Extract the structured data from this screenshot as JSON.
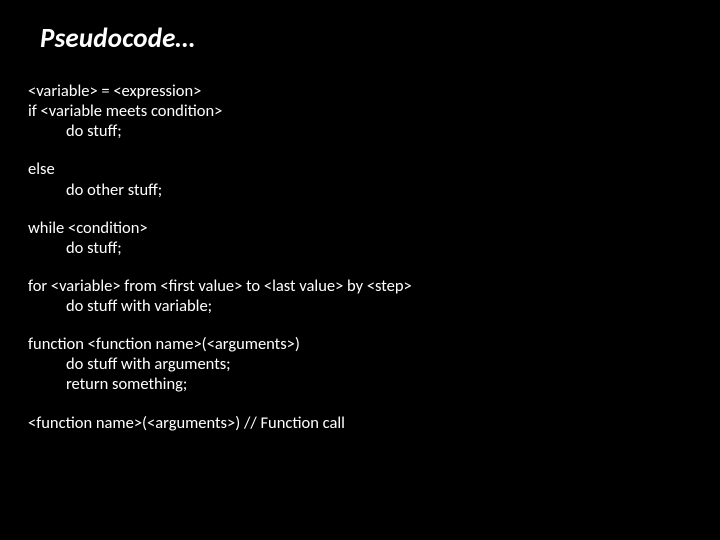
{
  "title": "Pseudocode…",
  "blocks": [
    {
      "lines": [
        {
          "text": "<variable> = <expression>",
          "indent": false
        },
        {
          "text": "if <variable meets condition>",
          "indent": false
        },
        {
          "text": "do stuff;",
          "indent": true
        }
      ]
    },
    {
      "lines": [
        {
          "text": "else",
          "indent": false
        },
        {
          "text": "do other stuff;",
          "indent": true
        }
      ]
    },
    {
      "lines": [
        {
          "text": "while <condition>",
          "indent": false
        },
        {
          "text": "do stuff;",
          "indent": true
        }
      ]
    },
    {
      "lines": [
        {
          "text": "for <variable> from <first value> to <last value> by <step>",
          "indent": false
        },
        {
          "text": "do stuff with variable;",
          "indent": true
        }
      ]
    },
    {
      "lines": [
        {
          "text": "function <function name>(<arguments>)",
          "indent": false
        },
        {
          "text": "do stuff with arguments;",
          "indent": true
        },
        {
          "text": "return something;",
          "indent": true
        }
      ]
    },
    {
      "lines": [
        {
          "text": "<function name>(<arguments>) // Function call",
          "indent": false
        }
      ]
    }
  ]
}
